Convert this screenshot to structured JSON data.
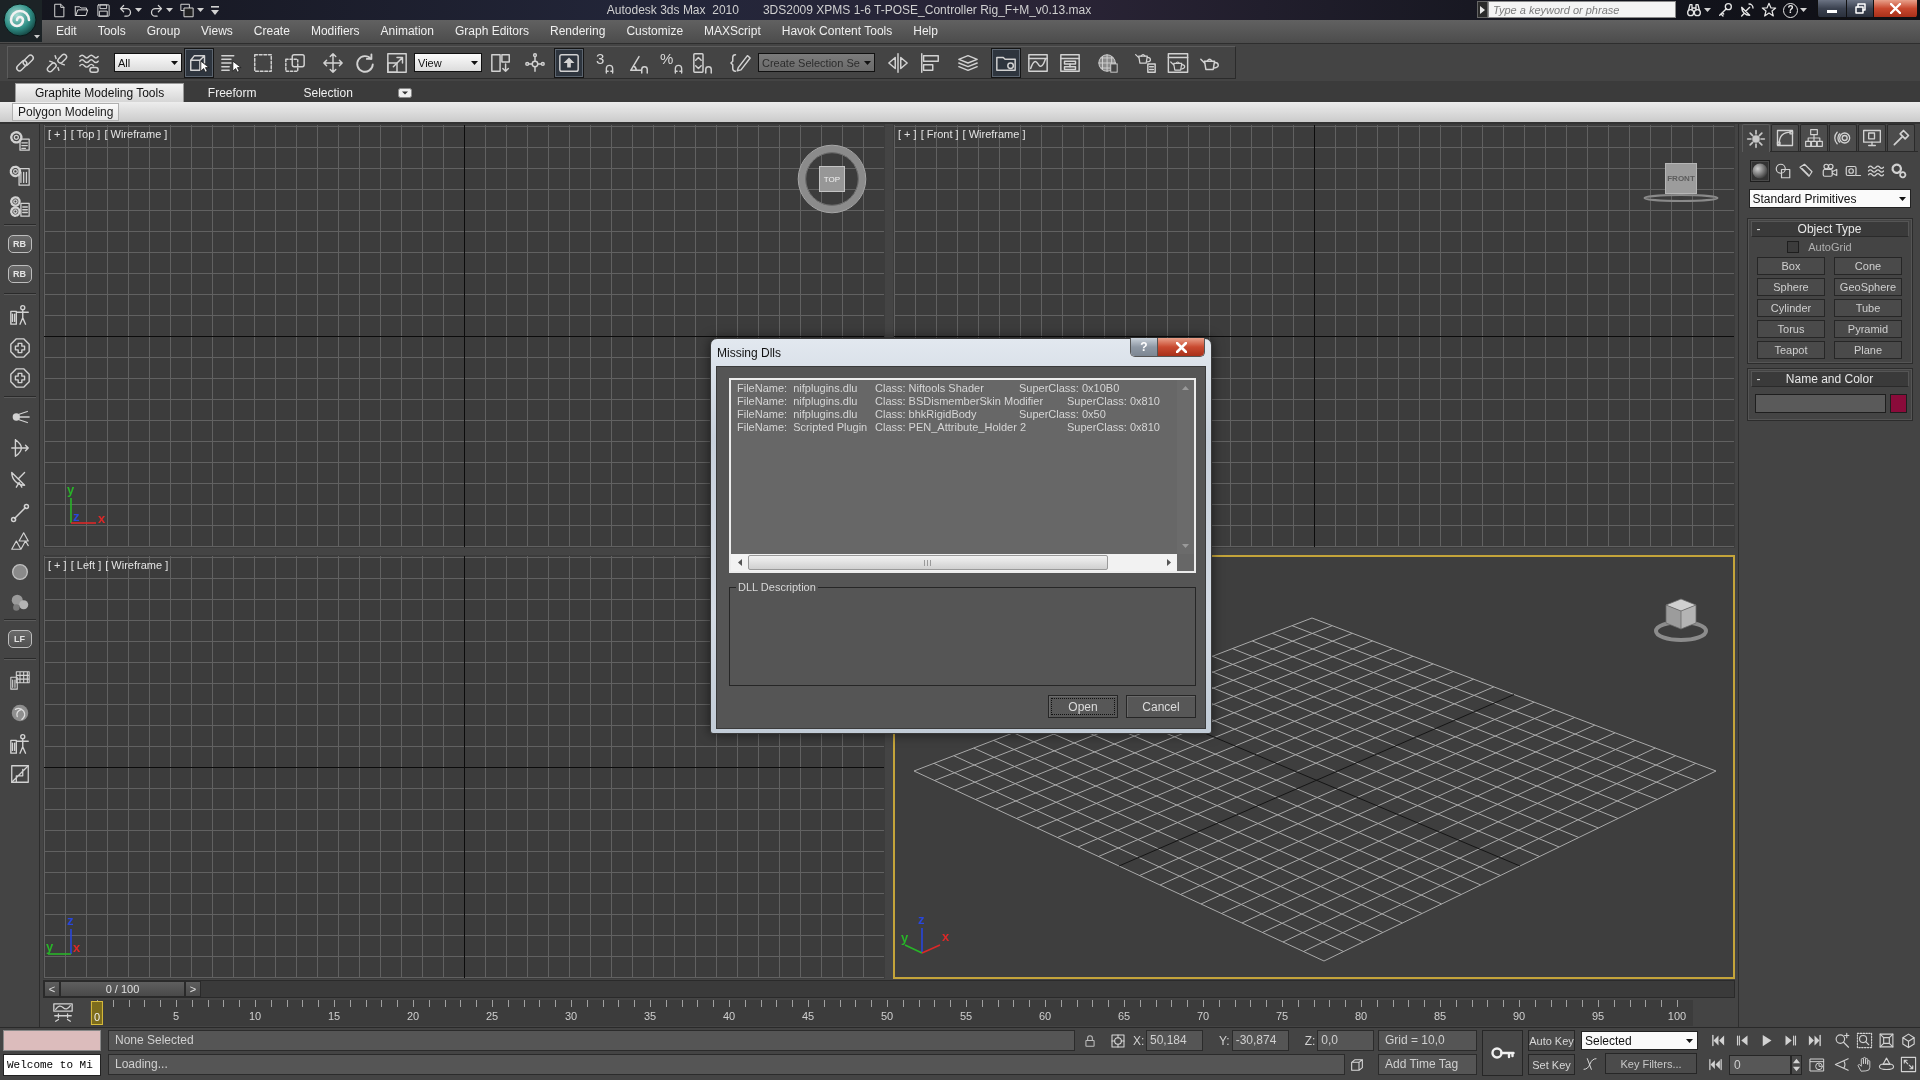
{
  "title_bar": {
    "app_title": "Autodesk 3ds Max  2010",
    "file_title": "3DS2009 XPMS 1-6 T-POSE_Controller Rig_F+M_v0.13.max",
    "search": {
      "placeholder": "Type a keyword or phrase"
    },
    "help": "?"
  },
  "menu_bar": [
    "Edit",
    "Tools",
    "Group",
    "Views",
    "Create",
    "Modifiers",
    "Animation",
    "Graph Editors",
    "Rendering",
    "Customize",
    "MAXScript",
    "Havok Content Tools",
    "Help"
  ],
  "main_toolbar": [
    {
      "kind": "button",
      "on": false
    },
    {
      "kind": "button",
      "on": false
    },
    {
      "kind": "button",
      "on": false
    },
    {
      "kind": "dropdown",
      "value": "All",
      "disabled": false
    },
    {
      "kind": "button",
      "on": true
    },
    {
      "kind": "button",
      "on": false
    },
    {
      "kind": "button",
      "on": false
    },
    {
      "kind": "button",
      "on": false
    },
    {
      "kind": "button",
      "on": false
    },
    {
      "kind": "button",
      "on": false
    },
    {
      "kind": "button",
      "on": false
    },
    {
      "kind": "dropdown",
      "value": "View",
      "disabled": false
    },
    {
      "kind": "button",
      "on": false
    },
    {
      "kind": "button",
      "on": false
    },
    {
      "kind": "button",
      "on": true
    },
    {
      "kind": "button",
      "label": "3",
      "on": false
    },
    {
      "kind": "button",
      "on": false
    },
    {
      "kind": "button",
      "label": "%",
      "on": false
    },
    {
      "kind": "button",
      "on": false
    },
    {
      "kind": "button",
      "on": false
    },
    {
      "kind": "dropdown",
      "value": "Create Selection Se",
      "disabled": true
    },
    {
      "kind": "button",
      "on": false
    },
    {
      "kind": "button",
      "on": false
    },
    {
      "kind": "button",
      "on": false
    },
    {
      "kind": "button",
      "on": true
    },
    {
      "kind": "button",
      "on": false
    },
    {
      "kind": "button",
      "on": false
    },
    {
      "kind": "button",
      "on": false
    },
    {
      "kind": "button",
      "on": false
    },
    {
      "kind": "button",
      "on": false
    },
    {
      "kind": "button",
      "on": false
    }
  ],
  "ribbon": {
    "tabs": [
      {
        "label": "Graphite Modeling Tools",
        "selected": true
      },
      {
        "label": "Freeform",
        "selected": false
      },
      {
        "label": "Selection",
        "selected": false
      }
    ],
    "panels": [
      "Polygon Modeling"
    ]
  },
  "left_toolbar": [
    {
      "kind": "icon"
    },
    {
      "kind": "icon"
    },
    {
      "kind": "icon"
    },
    {
      "kind": "text",
      "label": "RB"
    },
    {
      "kind": "text",
      "label": "RB"
    },
    {
      "kind": "icon"
    },
    {
      "kind": "icon"
    },
    {
      "kind": "icon"
    },
    {
      "kind": "icon"
    },
    {
      "kind": "icon"
    },
    {
      "kind": "icon"
    },
    {
      "kind": "icon"
    },
    {
      "kind": "icon"
    },
    {
      "kind": "icon"
    },
    {
      "kind": "icon"
    },
    {
      "kind": "text",
      "label": "LF"
    },
    {
      "kind": "icon"
    },
    {
      "kind": "icon"
    },
    {
      "kind": "icon"
    },
    {
      "kind": "icon"
    }
  ],
  "viewports": [
    {
      "kind": "ortho",
      "active": false,
      "labels": [
        "[ + ]",
        "[ Top ]",
        "[ Wireframe ]"
      ],
      "view_cube": {
        "kind": "top",
        "label": "TOP"
      },
      "axes": [
        {
          "label": "y",
          "kind": "up",
          "color": "#28b428"
        },
        {
          "label": "z",
          "kind": "origin",
          "color": "#2846dc"
        },
        {
          "label": "x",
          "kind": "right",
          "color": "#dc2828"
        }
      ]
    },
    {
      "kind": "ortho",
      "active": false,
      "labels": [
        "[ + ]",
        "[ Front ]",
        "[ Wireframe ]"
      ],
      "view_cube": {
        "kind": "front",
        "label": "FRONT"
      }
    },
    {
      "kind": "ortho",
      "active": false,
      "labels": [
        "[ + ]",
        "[ Left ]",
        "[ Wireframe ]"
      ],
      "axes": [
        {
          "label": "z",
          "kind": "up",
          "color": "#2846dc"
        },
        {
          "label": "y",
          "kind": "left",
          "color": "#28b428"
        },
        {
          "label": "x",
          "kind": "origin",
          "color": "#dc2828"
        }
      ]
    },
    {
      "kind": "perspective",
      "active": true,
      "view_cube": {
        "kind": "perspective"
      },
      "axes": [
        {
          "label": "z",
          "kind": "up",
          "color": "#2846dc"
        },
        {
          "label": "y",
          "kind": "upleft",
          "color": "#28b428"
        },
        {
          "label": "x",
          "kind": "upright",
          "color": "#dc2828"
        }
      ]
    }
  ],
  "time_slider": {
    "previous": "<",
    "thumb": "0 / 100",
    "next": ">",
    "level": 0
  },
  "timeline": {
    "ticks": [
      {
        "label": "0",
        "selected": true
      },
      {
        "label": "5",
        "selected": false
      },
      {
        "label": "10",
        "selected": false
      },
      {
        "label": "15",
        "selected": false
      },
      {
        "label": "20",
        "selected": false
      },
      {
        "label": "25",
        "selected": false
      },
      {
        "label": "30",
        "selected": false
      },
      {
        "label": "35",
        "selected": false
      },
      {
        "label": "40",
        "selected": false
      },
      {
        "label": "45",
        "selected": false
      },
      {
        "label": "50",
        "selected": false
      },
      {
        "label": "55",
        "selected": false
      },
      {
        "label": "60",
        "selected": false
      },
      {
        "label": "65",
        "selected": false
      },
      {
        "label": "70",
        "selected": false
      },
      {
        "label": "75",
        "selected": false
      },
      {
        "label": "80",
        "selected": false
      },
      {
        "label": "85",
        "selected": false
      },
      {
        "label": "90",
        "selected": false
      },
      {
        "label": "95",
        "selected": false
      },
      {
        "label": "100",
        "selected": false
      }
    ]
  },
  "command_panel": {
    "tabs": [
      {
        "selected": true
      },
      {
        "selected": false
      },
      {
        "selected": false
      },
      {
        "selected": false
      },
      {
        "selected": false
      },
      {
        "selected": false
      }
    ],
    "categories": [
      {
        "selected": true
      },
      {
        "selected": false
      },
      {
        "selected": false
      },
      {
        "selected": false
      },
      {
        "selected": false
      },
      {
        "selected": false
      },
      {
        "selected": false
      }
    ],
    "dropdown": "Standard Primitives",
    "rollouts": [
      {
        "kind": "object_type",
        "sign": "-",
        "title": "Object Type",
        "autogrid": {
          "label": "AutoGrid",
          "checked": false
        },
        "buttons": [
          "Box",
          "Cone",
          "Sphere",
          "GeoSphere",
          "Cylinder",
          "Tube",
          "Torus",
          "Pyramid",
          "Teapot",
          "Plane"
        ]
      },
      {
        "kind": "name_color",
        "sign": "-",
        "title": "Name and Color",
        "color": "#8a0b3a"
      }
    ]
  },
  "status_bar": {
    "listener_output": "Welcome to Mi",
    "selection": "None Selected",
    "prompt": "Loading...",
    "coordinates": [
      {
        "label": "X:",
        "value": "50,184"
      },
      {
        "label": "Y:",
        "value": "-30,874"
      },
      {
        "label": "Z:",
        "value": "0,0"
      }
    ],
    "grid": "Grid = 10,0",
    "time_tag": "Add Time Tag",
    "auto_key": {
      "label": "Auto Key",
      "on": false
    },
    "set_key": "Set Key",
    "key_set": "Selected",
    "key_filters": "Key Filters...",
    "frame": "0"
  },
  "dialog": {
    "title": "Missing Dlls",
    "help": "?",
    "rows": [
      {
        "file": "FileName:  nifplugins.dlu",
        "class": "Class: Niftools Shader",
        "superclass": "SuperClass: 0x10B0"
      },
      {
        "file": "FileName:  nifplugins.dlu",
        "class": "Class: BSDismemberSkin Modifier",
        "superclass": "SuperClass: 0x810"
      },
      {
        "file": "FileName:  nifplugins.dlu",
        "class": "Class: bhkRigidBody",
        "superclass": "SuperClass: 0x50"
      },
      {
        "file": "FileName:  Scripted Plugin",
        "class": "Class: PEN_Attribute_Holder 2",
        "superclass": "SuperClass: 0x810"
      }
    ],
    "description_label": "DLL Description",
    "buttons": [
      {
        "label": "Open",
        "focused": true
      },
      {
        "label": "Cancel",
        "focused": false
      }
    ]
  }
}
